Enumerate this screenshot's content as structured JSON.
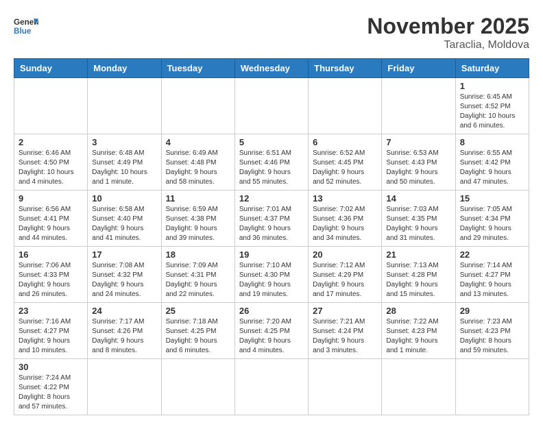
{
  "header": {
    "logo_general": "General",
    "logo_blue": "Blue",
    "month_title": "November 2025",
    "location": "Taraclia, Moldova"
  },
  "days_of_week": [
    "Sunday",
    "Monday",
    "Tuesday",
    "Wednesday",
    "Thursday",
    "Friday",
    "Saturday"
  ],
  "weeks": [
    [
      {
        "day": "",
        "info": ""
      },
      {
        "day": "",
        "info": ""
      },
      {
        "day": "",
        "info": ""
      },
      {
        "day": "",
        "info": ""
      },
      {
        "day": "",
        "info": ""
      },
      {
        "day": "",
        "info": ""
      },
      {
        "day": "1",
        "info": "Sunrise: 6:45 AM\nSunset: 4:52 PM\nDaylight: 10 hours and 6 minutes."
      }
    ],
    [
      {
        "day": "2",
        "info": "Sunrise: 6:46 AM\nSunset: 4:50 PM\nDaylight: 10 hours and 4 minutes."
      },
      {
        "day": "3",
        "info": "Sunrise: 6:48 AM\nSunset: 4:49 PM\nDaylight: 10 hours and 1 minute."
      },
      {
        "day": "4",
        "info": "Sunrise: 6:49 AM\nSunset: 4:48 PM\nDaylight: 9 hours and 58 minutes."
      },
      {
        "day": "5",
        "info": "Sunrise: 6:51 AM\nSunset: 4:46 PM\nDaylight: 9 hours and 55 minutes."
      },
      {
        "day": "6",
        "info": "Sunrise: 6:52 AM\nSunset: 4:45 PM\nDaylight: 9 hours and 52 minutes."
      },
      {
        "day": "7",
        "info": "Sunrise: 6:53 AM\nSunset: 4:43 PM\nDaylight: 9 hours and 50 minutes."
      },
      {
        "day": "8",
        "info": "Sunrise: 6:55 AM\nSunset: 4:42 PM\nDaylight: 9 hours and 47 minutes."
      }
    ],
    [
      {
        "day": "9",
        "info": "Sunrise: 6:56 AM\nSunset: 4:41 PM\nDaylight: 9 hours and 44 minutes."
      },
      {
        "day": "10",
        "info": "Sunrise: 6:58 AM\nSunset: 4:40 PM\nDaylight: 9 hours and 41 minutes."
      },
      {
        "day": "11",
        "info": "Sunrise: 6:59 AM\nSunset: 4:38 PM\nDaylight: 9 hours and 39 minutes."
      },
      {
        "day": "12",
        "info": "Sunrise: 7:01 AM\nSunset: 4:37 PM\nDaylight: 9 hours and 36 minutes."
      },
      {
        "day": "13",
        "info": "Sunrise: 7:02 AM\nSunset: 4:36 PM\nDaylight: 9 hours and 34 minutes."
      },
      {
        "day": "14",
        "info": "Sunrise: 7:03 AM\nSunset: 4:35 PM\nDaylight: 9 hours and 31 minutes."
      },
      {
        "day": "15",
        "info": "Sunrise: 7:05 AM\nSunset: 4:34 PM\nDaylight: 9 hours and 29 minutes."
      }
    ],
    [
      {
        "day": "16",
        "info": "Sunrise: 7:06 AM\nSunset: 4:33 PM\nDaylight: 9 hours and 26 minutes."
      },
      {
        "day": "17",
        "info": "Sunrise: 7:08 AM\nSunset: 4:32 PM\nDaylight: 9 hours and 24 minutes."
      },
      {
        "day": "18",
        "info": "Sunrise: 7:09 AM\nSunset: 4:31 PM\nDaylight: 9 hours and 22 minutes."
      },
      {
        "day": "19",
        "info": "Sunrise: 7:10 AM\nSunset: 4:30 PM\nDaylight: 9 hours and 19 minutes."
      },
      {
        "day": "20",
        "info": "Sunrise: 7:12 AM\nSunset: 4:29 PM\nDaylight: 9 hours and 17 minutes."
      },
      {
        "day": "21",
        "info": "Sunrise: 7:13 AM\nSunset: 4:28 PM\nDaylight: 9 hours and 15 minutes."
      },
      {
        "day": "22",
        "info": "Sunrise: 7:14 AM\nSunset: 4:27 PM\nDaylight: 9 hours and 13 minutes."
      }
    ],
    [
      {
        "day": "23",
        "info": "Sunrise: 7:16 AM\nSunset: 4:27 PM\nDaylight: 9 hours and 10 minutes."
      },
      {
        "day": "24",
        "info": "Sunrise: 7:17 AM\nSunset: 4:26 PM\nDaylight: 9 hours and 8 minutes."
      },
      {
        "day": "25",
        "info": "Sunrise: 7:18 AM\nSunset: 4:25 PM\nDaylight: 9 hours and 6 minutes."
      },
      {
        "day": "26",
        "info": "Sunrise: 7:20 AM\nSunset: 4:25 PM\nDaylight: 9 hours and 4 minutes."
      },
      {
        "day": "27",
        "info": "Sunrise: 7:21 AM\nSunset: 4:24 PM\nDaylight: 9 hours and 3 minutes."
      },
      {
        "day": "28",
        "info": "Sunrise: 7:22 AM\nSunset: 4:23 PM\nDaylight: 9 hours and 1 minute."
      },
      {
        "day": "29",
        "info": "Sunrise: 7:23 AM\nSunset: 4:23 PM\nDaylight: 8 hours and 59 minutes."
      }
    ],
    [
      {
        "day": "30",
        "info": "Sunrise: 7:24 AM\nSunset: 4:22 PM\nDaylight: 8 hours and 57 minutes."
      },
      {
        "day": "",
        "info": ""
      },
      {
        "day": "",
        "info": ""
      },
      {
        "day": "",
        "info": ""
      },
      {
        "day": "",
        "info": ""
      },
      {
        "day": "",
        "info": ""
      },
      {
        "day": "",
        "info": ""
      }
    ]
  ]
}
